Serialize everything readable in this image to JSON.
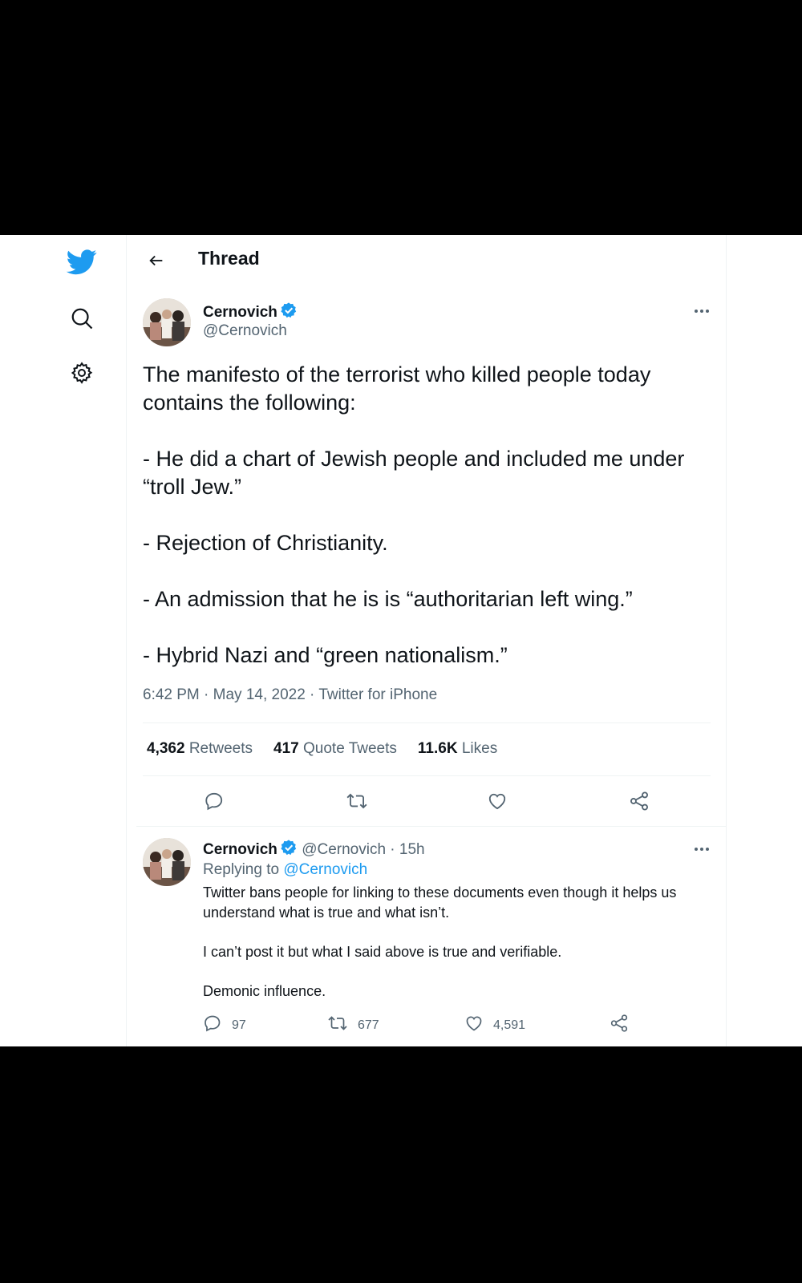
{
  "header": {
    "title": "Thread"
  },
  "main_tweet": {
    "author_name": "Cernovich",
    "author_handle": "@Cernovich",
    "paragraphs": [
      "The manifesto of the terrorist who killed people today contains the following:",
      "- He did a chart of Jewish people and included me under “troll Jew.”",
      "- Rejection of Christianity.",
      "- An admission that he is is “authoritarian left wing.”",
      "- Hybrid Nazi and “green nationalism.”"
    ],
    "meta": "6:42 PM · May 14, 2022 · Twitter for iPhone",
    "stats": {
      "retweets_count": "4,362",
      "retweets_label": "Retweets",
      "quotes_count": "417",
      "quotes_label": "Quote Tweets",
      "likes_count": "11.6K",
      "likes_label": "Likes"
    }
  },
  "reply_tweet": {
    "author_name": "Cernovich",
    "author_handle_time": "@Cernovich · 15h",
    "replying_prefix": "Replying to",
    "replying_handle": "@Cernovich",
    "paragraphs": [
      "Twitter bans people for linking to these documents even though it helps us understand what is true and what isn’t.",
      "I can’t post it but what I said above is true and verifiable.",
      "Demonic influence."
    ],
    "reply_count": "97",
    "retweet_count": "677",
    "like_count": "4,591"
  },
  "colors": {
    "brand": "#1d9bf0",
    "text": "#0f1419",
    "muted": "#536471",
    "divider": "#eff3f4"
  },
  "icons": [
    "twitter-bird-icon",
    "search-icon",
    "gear-icon",
    "back-arrow-icon",
    "verified-badge-icon",
    "more-icon",
    "reply-icon",
    "retweet-icon",
    "like-icon",
    "share-icon"
  ]
}
